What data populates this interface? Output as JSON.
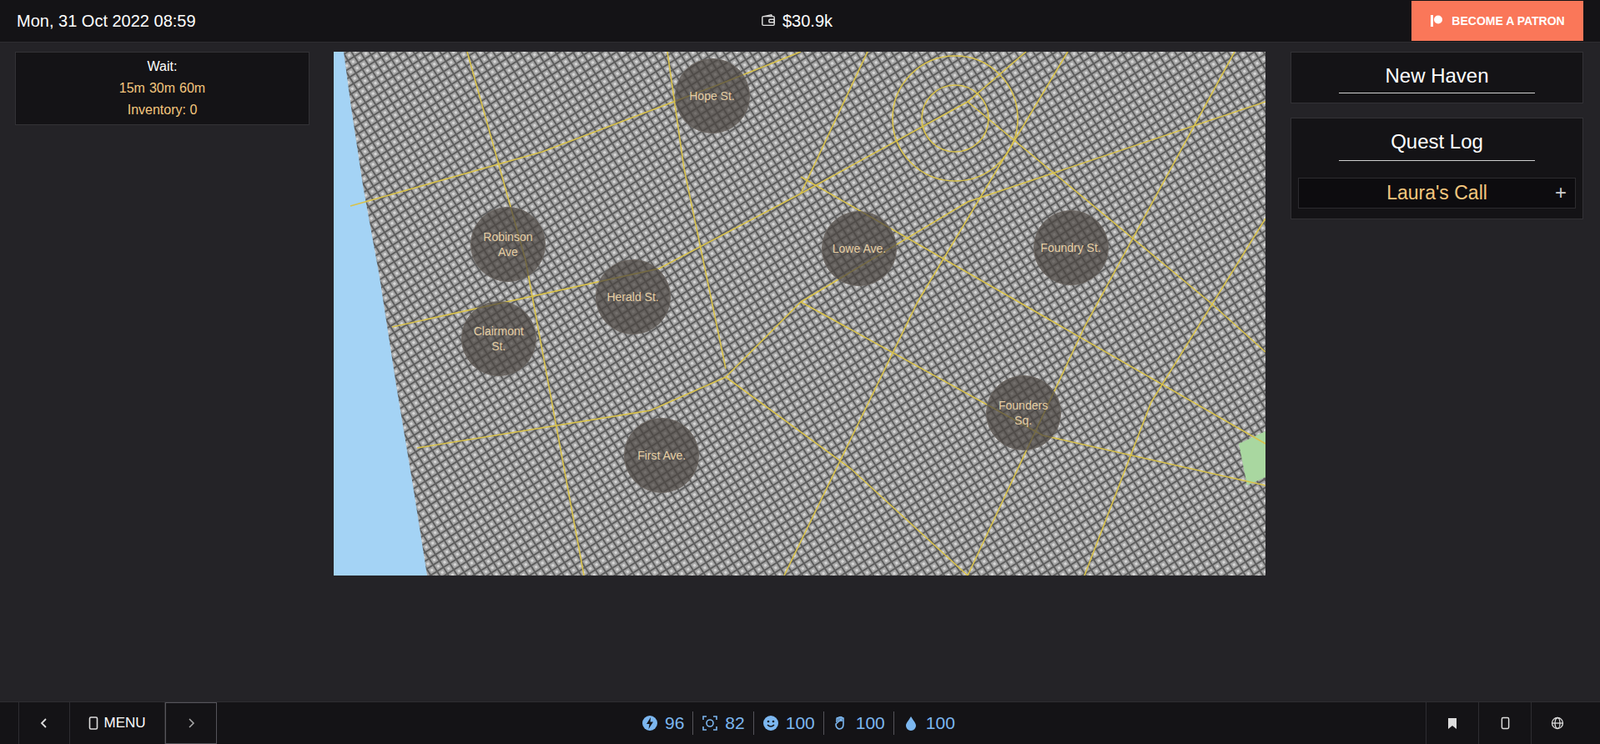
{
  "top_bar": {
    "datetime": "Mon, 31 Oct 2022 08:59",
    "money": "$30.9k",
    "patron_button": "BECOME A PATRON"
  },
  "wait_panel": {
    "title": "Wait:",
    "options": [
      "15m",
      "30m",
      "60m"
    ],
    "inventory": "Inventory: 0"
  },
  "map": {
    "locations": [
      {
        "label": "Hope St."
      },
      {
        "label": "Robinson Ave"
      },
      {
        "label": "Herald St."
      },
      {
        "label": "Clairmont St."
      },
      {
        "label": "Lowe Ave."
      },
      {
        "label": "Foundry St."
      },
      {
        "label": "Founders Sq."
      },
      {
        "label": "First Ave."
      }
    ]
  },
  "sidebar": {
    "city": "New Haven",
    "quest_log": {
      "title": "Quest Log",
      "quests": [
        {
          "name": "Laura's Call",
          "expand": "+"
        }
      ]
    }
  },
  "bottom_bar": {
    "menu": "MENU",
    "stats": [
      {
        "value": "96"
      },
      {
        "value": "82"
      },
      {
        "value": "100"
      },
      {
        "value": "100"
      },
      {
        "value": "100"
      }
    ]
  }
}
